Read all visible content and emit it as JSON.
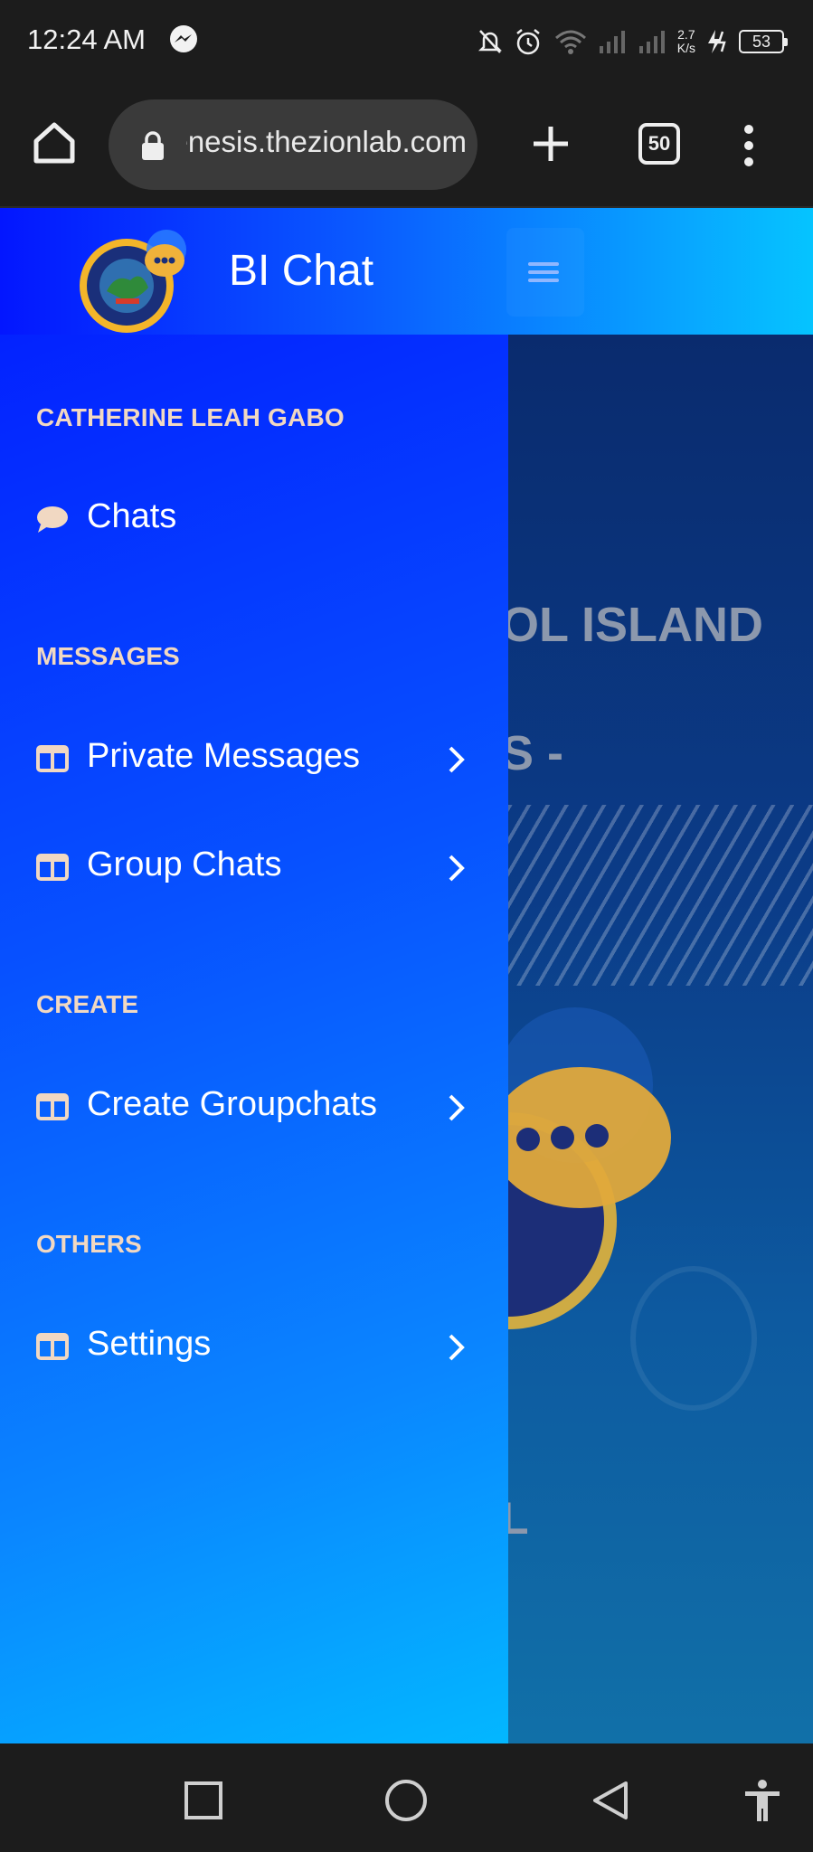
{
  "status_bar": {
    "time": "12:24 AM",
    "net_speed_value": "2.7",
    "net_speed_unit": "K/s",
    "battery": "53",
    "icons": [
      "messenger-icon",
      "bell-off-icon",
      "alarm-icon",
      "wifi-icon",
      "signal-icon",
      "signal-icon",
      "charging-icon",
      "battery-icon"
    ]
  },
  "browser": {
    "url": "genesis.thezionlab.com",
    "tab_count": "50",
    "icons": [
      "home-icon",
      "lock-icon",
      "plus-icon",
      "tabs-icon",
      "more-vert-icon"
    ]
  },
  "app": {
    "title": "BI Chat",
    "icons": [
      "logo-seal",
      "hamburger-icon"
    ]
  },
  "sidebar": {
    "user_name": "CATHERINE LEAH GABO",
    "chats_label": "Chats",
    "sections": [
      {
        "label": "MESSAGES",
        "items": [
          {
            "label": "Private Messages"
          },
          {
            "label": "Group Chats"
          }
        ]
      },
      {
        "label": "CREATE",
        "items": [
          {
            "label": "Create Groupchats"
          }
        ]
      },
      {
        "label": "OTHERS",
        "items": [
          {
            "label": "Settings"
          }
        ]
      }
    ]
  },
  "background": {
    "line1": "OL ISLAND",
    "line2": "S -",
    "line3": "L"
  },
  "colors": {
    "header_start": "#0316ff",
    "header_end": "#05c4ff",
    "section_label": "#f1d8c2",
    "accent_gold": "#f0b23a"
  },
  "nav_bar": {
    "icons": [
      "recents-square-icon",
      "home-circle-icon",
      "back-triangle-icon",
      "accessibility-icon"
    ]
  }
}
